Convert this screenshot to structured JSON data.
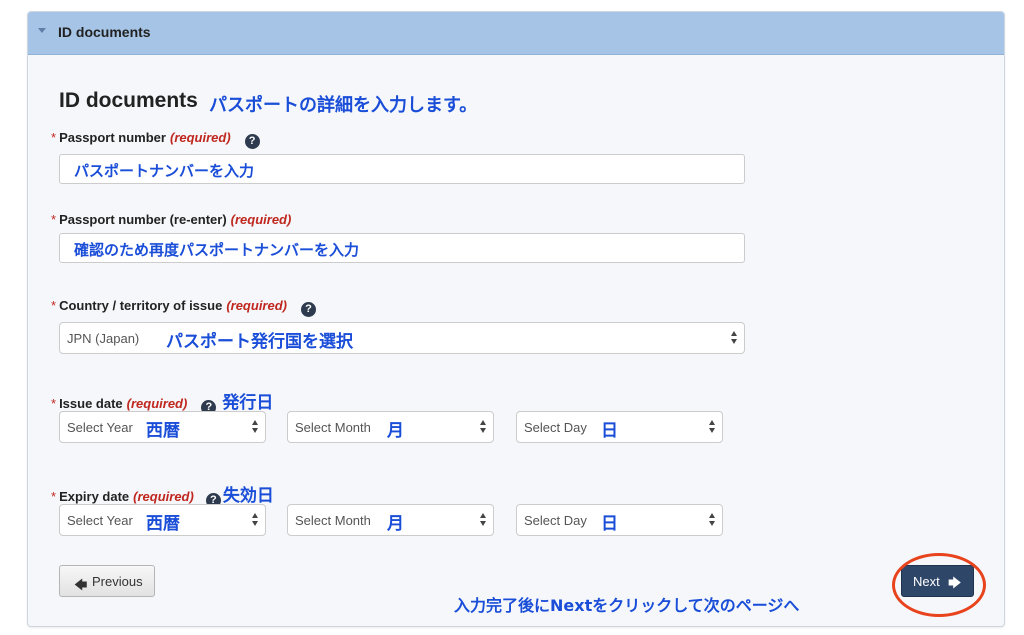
{
  "panel": {
    "title": "ID documents"
  },
  "section": {
    "title": "ID documents",
    "annotation": "パスポートの詳細を入力します。"
  },
  "passport_number": {
    "label": "Passport number",
    "required": "(required)",
    "help_icon": "?",
    "annotation": "パスポートナンバーを入力"
  },
  "passport_reenter": {
    "label": "Passport number (re-enter)",
    "required": "(required)",
    "annotation": "確認のため再度パスポートナンバーを入力"
  },
  "country": {
    "label": "Country / territory of issue",
    "required": "(required)",
    "help_icon": "?",
    "selected": "JPN (Japan)",
    "annotation": "パスポート発行国を選択"
  },
  "issue_date": {
    "label": "Issue date",
    "required": "(required)",
    "help_icon": "?",
    "annotation": "発行日",
    "year": {
      "selected": "Select Year",
      "annotation": "西暦"
    },
    "month": {
      "selected": "Select Month",
      "annotation": "月"
    },
    "day": {
      "selected": "Select Day",
      "annotation": "日"
    }
  },
  "expiry_date": {
    "label": "Expiry date",
    "required": "(required)",
    "help_icon": "?",
    "annotation": "失効日",
    "year": {
      "selected": "Select Year",
      "annotation": "西暦"
    },
    "month": {
      "selected": "Select Month",
      "annotation": "月"
    },
    "day": {
      "selected": "Select Day",
      "annotation": "日"
    }
  },
  "buttons": {
    "previous": "Previous",
    "next": "Next"
  },
  "footer_annotation": "入力完了後にNextをクリックして次のページへ",
  "colors": {
    "header": "#a5c4e6",
    "required": "#c0271f",
    "annotation": "#1a4ed8",
    "next_button": "#2e4668",
    "highlight_circle": "#e8431d"
  },
  "icons": {
    "header_caret": "caret-down-icon",
    "help": "question-circle-icon",
    "previous": "arrow-left-icon",
    "next": "arrow-right-icon"
  }
}
